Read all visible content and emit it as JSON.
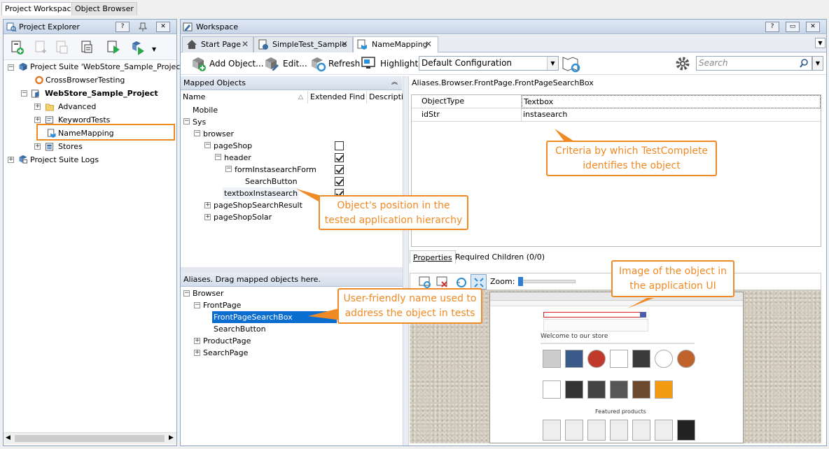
{
  "top_tabs": [
    "Project Workspace",
    "Object Browser"
  ],
  "explorer": {
    "title": "Project Explorer",
    "tree": [
      {
        "label": "Project Suite 'WebStore_Sample_Project_S"
      },
      {
        "label": "CrossBrowserTesting"
      },
      {
        "label": "WebStore_Sample_Project"
      },
      {
        "label": "Advanced"
      },
      {
        "label": "KeywordTests"
      },
      {
        "label": "NameMapping"
      },
      {
        "label": "Stores"
      },
      {
        "label": "Project Suite Logs"
      }
    ]
  },
  "workspace": {
    "title": "Workspace",
    "tabs": [
      "Start Page",
      "SimpleTest_Sample",
      "NameMapping"
    ],
    "toolbar": {
      "add_object": "Add Object...",
      "edit": "Edit...",
      "refresh": "Refresh",
      "highlight": "Highlight",
      "configuration": "Default Configuration",
      "search_placeholder": "Search"
    }
  },
  "mapped_objects": {
    "title": "Mapped Objects",
    "columns": [
      "Name",
      "Extended Find",
      "Descriptio"
    ],
    "rows": [
      {
        "label": "Mobile",
        "checked": null
      },
      {
        "label": "Sys",
        "checked": null
      },
      {
        "label": "browser",
        "checked": null
      },
      {
        "label": "pageShop",
        "checked": false
      },
      {
        "label": "header",
        "checked": true
      },
      {
        "label": "formInstasearchForm",
        "checked": true
      },
      {
        "label": "SearchButton",
        "checked": true
      },
      {
        "label": "textboxInstasearch",
        "checked": true
      },
      {
        "label": "pageShopSearchResult",
        "checked": null
      },
      {
        "label": "pageShopSolar",
        "checked": null
      }
    ]
  },
  "aliases": {
    "title": "Aliases. Drag mapped objects here.",
    "rows": [
      "Browser",
      "FrontPage",
      "FrontPageSearchBox",
      "SearchButton",
      "ProductPage",
      "SearchPage"
    ]
  },
  "properties": {
    "path": "Aliases.Browser.FrontPage.FrontPageSearchBox",
    "rows": [
      {
        "name": "ObjectType",
        "value": "Textbox"
      },
      {
        "name": "idStr",
        "value": "instasearch"
      }
    ],
    "tabs": [
      "Properties",
      "Required Children (0/0)"
    ]
  },
  "image_toolbar": {
    "zoom_label": "Zoom:"
  },
  "callouts": {
    "criteria": "Criteria by which TestComplete identifies the object",
    "position": "Object's position in the tested application hierarchy",
    "friendly": "User-friendly name used to address the object in tests",
    "image": "Image of the object in the application UI"
  },
  "screenshot": {
    "welcome": "Welcome to our store",
    "featured": "Featured products"
  },
  "colors": {
    "accent": "#f08a24",
    "selection": "#0a6ed1",
    "panel_border": "#8ea6c6"
  }
}
